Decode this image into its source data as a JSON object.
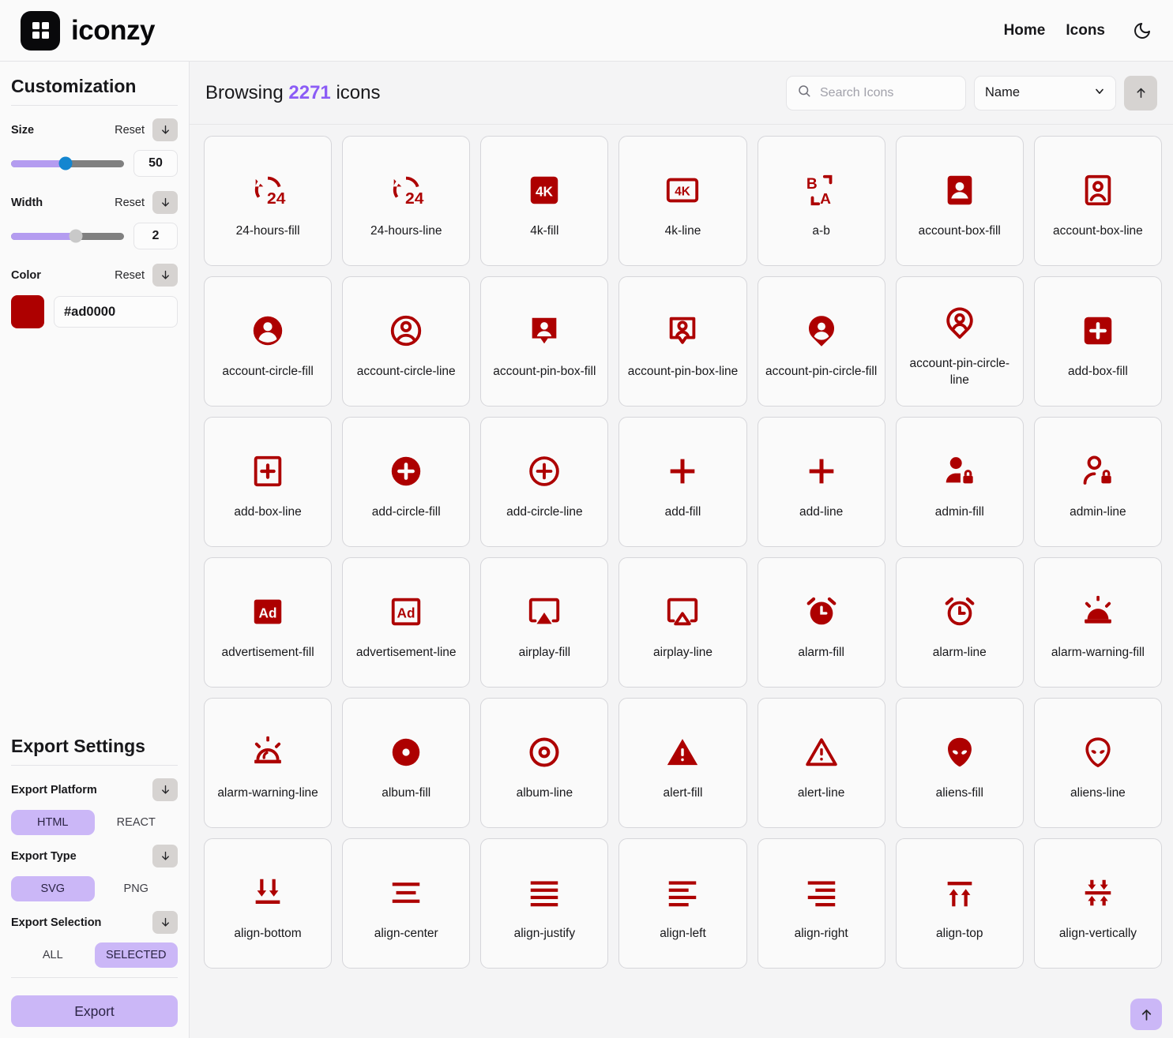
{
  "header": {
    "brand_name": "iconzy",
    "logo_icon": "grid-logo-icon",
    "nav": [
      {
        "label": "Home",
        "name": "nav-home"
      },
      {
        "label": "Icons",
        "name": "nav-icons"
      }
    ],
    "theme_toggle_icon": "moon-icon"
  },
  "sidebar": {
    "customization_title": "Customization",
    "controls": [
      {
        "label": "Size",
        "reset_label": "Reset",
        "value": "50",
        "fill_percent": 48,
        "knob_color": "#1486d0"
      },
      {
        "label": "Width",
        "reset_label": "Reset",
        "value": "2",
        "fill_percent": 57,
        "knob_color": "#c9c9c9"
      }
    ],
    "color": {
      "label": "Color",
      "reset_label": "Reset",
      "hex": "#ad0000",
      "swatch_color": "#ad0000"
    },
    "export_title": "Export Settings",
    "export_groups": [
      {
        "label": "Export Platform",
        "options": [
          "HTML",
          "REACT"
        ],
        "selected": "HTML"
      },
      {
        "label": "Export Type",
        "options": [
          "SVG",
          "PNG"
        ],
        "selected": "SVG"
      },
      {
        "label": "Export Selection",
        "options": [
          "ALL",
          "SELECTED"
        ],
        "selected": "SELECTED"
      }
    ],
    "export_button_label": "Export"
  },
  "main": {
    "browsing_prefix": "Browsing",
    "icon_count": "2271",
    "browsing_suffix": "icons",
    "search_placeholder": "Search Icons",
    "search_value": "",
    "search_icon": "search-icon",
    "sort_select_value": "Name",
    "sort_select_options": [
      "Name"
    ],
    "sort_direction_icon": "arrow-up-icon",
    "scroll_top_icon": "arrow-up-icon",
    "accent_color": "#8b5cf6",
    "icon_color": "#ad0000",
    "icons": [
      {
        "name": "24-hours-fill",
        "glyph": "24-hours-fill"
      },
      {
        "name": "24-hours-line",
        "glyph": "24-hours-line"
      },
      {
        "name": "4k-fill",
        "glyph": "4k-fill"
      },
      {
        "name": "4k-line",
        "glyph": "4k-line"
      },
      {
        "name": "a-b",
        "glyph": "a-b"
      },
      {
        "name": "account-box-fill",
        "glyph": "account-box-fill"
      },
      {
        "name": "account-box-line",
        "glyph": "account-box-line"
      },
      {
        "name": "account-circle-fill",
        "glyph": "account-circle-fill"
      },
      {
        "name": "account-circle-line",
        "glyph": "account-circle-line"
      },
      {
        "name": "account-pin-box-fill",
        "glyph": "account-pin-box-fill"
      },
      {
        "name": "account-pin-box-line",
        "glyph": "account-pin-box-line"
      },
      {
        "name": "account-pin-circle-fill",
        "glyph": "account-pin-circle-fill"
      },
      {
        "name": "account-pin-circle-line",
        "glyph": "account-pin-circle-line"
      },
      {
        "name": "add-box-fill",
        "glyph": "add-box-fill"
      },
      {
        "name": "add-box-line",
        "glyph": "add-box-line"
      },
      {
        "name": "add-circle-fill",
        "glyph": "add-circle-fill"
      },
      {
        "name": "add-circle-line",
        "glyph": "add-circle-line"
      },
      {
        "name": "add-fill",
        "glyph": "add-fill"
      },
      {
        "name": "add-line",
        "glyph": "add-line"
      },
      {
        "name": "admin-fill",
        "glyph": "admin-fill"
      },
      {
        "name": "admin-line",
        "glyph": "admin-line"
      },
      {
        "name": "advertisement-fill",
        "glyph": "advertisement-fill"
      },
      {
        "name": "advertisement-line",
        "glyph": "advertisement-line"
      },
      {
        "name": "airplay-fill",
        "glyph": "airplay-fill"
      },
      {
        "name": "airplay-line",
        "glyph": "airplay-line"
      },
      {
        "name": "alarm-fill",
        "glyph": "alarm-fill"
      },
      {
        "name": "alarm-line",
        "glyph": "alarm-line"
      },
      {
        "name": "alarm-warning-fill",
        "glyph": "alarm-warning-fill"
      },
      {
        "name": "alarm-warning-line",
        "glyph": "alarm-warning-line"
      },
      {
        "name": "album-fill",
        "glyph": "album-fill"
      },
      {
        "name": "album-line",
        "glyph": "album-line"
      },
      {
        "name": "alert-fill",
        "glyph": "alert-fill"
      },
      {
        "name": "alert-line",
        "glyph": "alert-line"
      },
      {
        "name": "aliens-fill",
        "glyph": "aliens-fill"
      },
      {
        "name": "aliens-line",
        "glyph": "aliens-line"
      },
      {
        "name": "align-bottom",
        "glyph": "align-bottom"
      },
      {
        "name": "align-center",
        "glyph": "align-center"
      },
      {
        "name": "align-justify",
        "glyph": "align-justify"
      },
      {
        "name": "align-left",
        "glyph": "align-left"
      },
      {
        "name": "align-right",
        "glyph": "align-right"
      },
      {
        "name": "align-top",
        "glyph": "align-top"
      },
      {
        "name": "align-vertically",
        "glyph": "align-vertically"
      }
    ]
  }
}
